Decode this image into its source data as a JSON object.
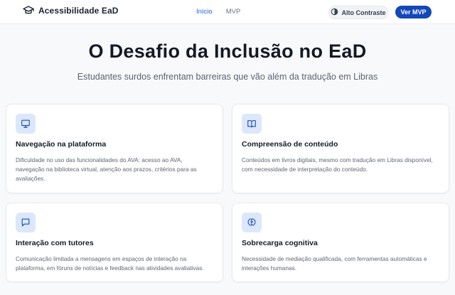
{
  "header": {
    "brand": "Acessibilidade EaD",
    "nav": [
      {
        "label": "Início",
        "active": true
      },
      {
        "label": "MVP",
        "active": false
      }
    ],
    "contrast_label": "Alto Contraste",
    "cta_label": "Ver MVP"
  },
  "hero": {
    "title": "O Desafio da Inclusão no EaD",
    "subtitle": "Estudantes surdos enfrentam barreiras que vão além da tradução em Libras"
  },
  "cards": [
    {
      "icon": "monitor-icon",
      "title": "Navegação na plataforma",
      "description": "Dificuldade no uso das funcionalidades do AVA: acesso ao AVA, navegação na biblioteca virtual, atenção aos prazos, critérios para as avaliações."
    },
    {
      "icon": "book-icon",
      "title": "Compreensão de conteúdo",
      "description": "Conteúdos em livros digitais, mesmo com tradução em Libras disponível, com necessidade de interpretação do conteúdo."
    },
    {
      "icon": "message-icon",
      "title": "Interação com tutores",
      "description": "Comunicação limitada a mensagens em espaços de interação na plataforma, em fóruns de notícias e feedback nas atividades avaliativas."
    },
    {
      "icon": "brain-icon",
      "title": "Sobrecarga cognitiva",
      "description": "Necessidade de mediação qualificada, com ferramentas automáticas e interações humanas."
    }
  ],
  "colors": {
    "accent": "#1447b8",
    "icon_bg": "#dbe7fb",
    "icon_stroke": "#1e4fae"
  }
}
